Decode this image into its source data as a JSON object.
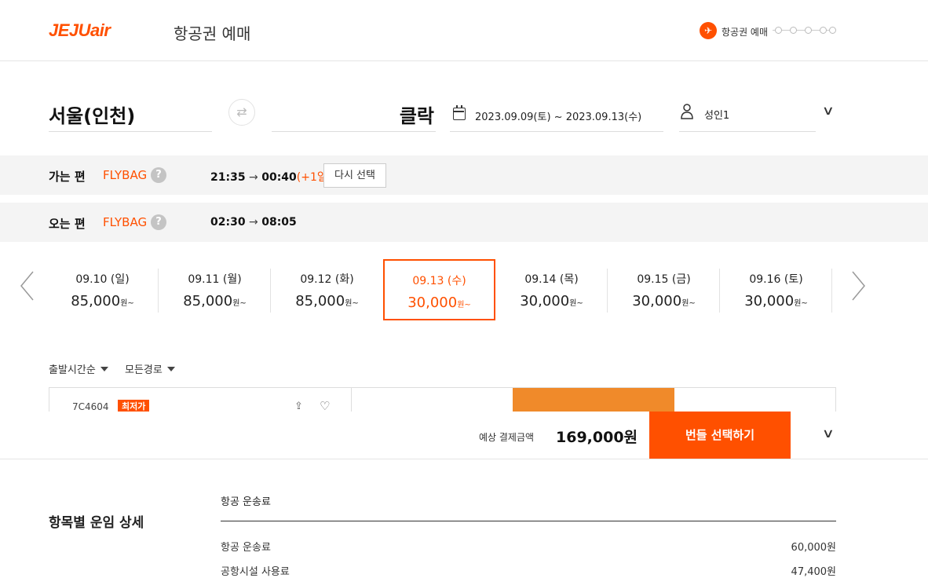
{
  "header": {
    "logo": "JEJUair",
    "title": "항공권 예매",
    "step_label": "항공권 예매"
  },
  "search": {
    "origin": "서울(인천)",
    "destination": "클락",
    "dates": "2023.09.09(토) ~ 2023.09.13(수)",
    "passengers": "성인1"
  },
  "legs": [
    {
      "label": "가는 편",
      "fare": "FLYBAG",
      "dep": "21:35",
      "arr": "00:40",
      "plus": "(+1일)",
      "action": "다시 선택"
    },
    {
      "label": "오는 편",
      "fare": "FLYBAG",
      "dep": "02:30",
      "arr": "08:05"
    }
  ],
  "dates": [
    {
      "label": "09.10 (일)",
      "price": "85,000",
      "unit": "원~"
    },
    {
      "label": "09.11 (월)",
      "price": "85,000",
      "unit": "원~"
    },
    {
      "label": "09.12 (화)",
      "price": "85,000",
      "unit": "원~"
    },
    {
      "label": "09.13 (수)",
      "price": "30,000",
      "unit": "원~"
    },
    {
      "label": "09.14 (목)",
      "price": "30,000",
      "unit": "원~"
    },
    {
      "label": "09.15 (금)",
      "price": "30,000",
      "unit": "원~"
    },
    {
      "label": "09.16 (토)",
      "price": "30,000",
      "unit": "원~"
    }
  ],
  "selected_date_index": 3,
  "sort": {
    "time": "출발시간순",
    "route": "모든경로"
  },
  "flight": {
    "number": "7C4604",
    "badge": "최저가"
  },
  "bottom": {
    "est_label": "예상 결제금액",
    "est_amount": "169,000원",
    "cta": "번들 선택하기"
  },
  "details": {
    "title": "항목별 운임 상세",
    "section": "항공 운송료",
    "rows": [
      {
        "label": "항공 운송료",
        "amount": "60,000원"
      },
      {
        "label": "공항시설 사용료",
        "amount": "47,400원"
      }
    ]
  },
  "colors": {
    "brand": "#ff5000",
    "fare_bar": "#f08a2a",
    "leg_bg": "#f4f4f4"
  }
}
